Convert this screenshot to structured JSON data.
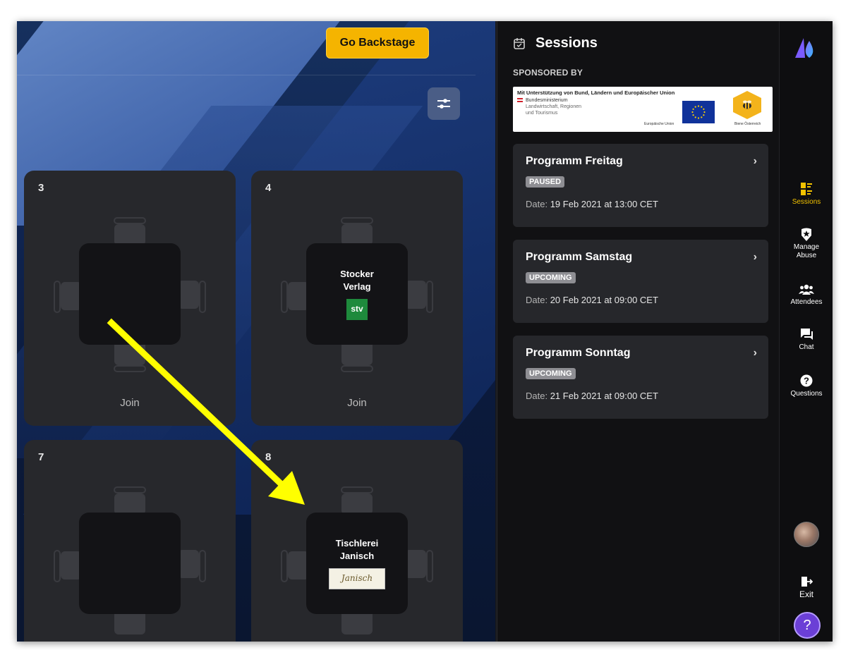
{
  "stage": {
    "backstage_label": "Go Backstage",
    "tables": [
      {
        "number": "3",
        "company": "",
        "company_line2": "",
        "logo": "",
        "join_label": "Join"
      },
      {
        "number": "4",
        "company": "Stocker",
        "company_line2": "Verlag",
        "logo": "stv",
        "join_label": "Join"
      },
      {
        "number": "7",
        "company": "",
        "company_line2": "",
        "logo": "",
        "join_label": ""
      },
      {
        "number": "8",
        "company": "Tischlerei",
        "company_line2": "Janisch",
        "logo": "Janisch",
        "join_label": ""
      }
    ]
  },
  "panel": {
    "title": "Sessions",
    "sponsored_label": "SPONSORED BY",
    "sponsor": {
      "heading": "Mit Unterstützung von Bund, Ländern und Europäischer Union",
      "ministry_line1": "Bundesministerium",
      "ministry_line2": "Landwirtschaft, Regionen",
      "ministry_line3": "und Tourismus",
      "eu_label": "Europäische Union",
      "bee_label": "Biene Österreich"
    },
    "sessions": [
      {
        "title": "Programm Freitag",
        "status": "PAUSED",
        "date_prefix": "Date:",
        "date": "19 Feb 2021 at 13:00 CET"
      },
      {
        "title": "Programm Samstag",
        "status": "UPCOMING",
        "date_prefix": "Date:",
        "date": "20 Feb 2021 at 09:00 CET"
      },
      {
        "title": "Programm Sonntag",
        "status": "UPCOMING",
        "date_prefix": "Date:",
        "date": "21 Feb 2021 at 09:00 CET"
      }
    ]
  },
  "rail": {
    "items": [
      {
        "label": "Sessions",
        "icon": "sessions-icon",
        "active": true
      },
      {
        "label": "Manage Abuse",
        "icon": "shield-star-icon",
        "active": false
      },
      {
        "label": "Attendees",
        "icon": "people-icon",
        "active": false
      },
      {
        "label": "Chat",
        "icon": "chat-icon",
        "active": false
      },
      {
        "label": "Questions",
        "icon": "question-icon",
        "active": false
      }
    ],
    "exit_label": "Exit",
    "help_label": "?"
  },
  "colors": {
    "accent_yellow": "#f5b400",
    "active_rail": "#f2c200",
    "help": "#6b3fd6",
    "arrow": "#ffff00"
  }
}
